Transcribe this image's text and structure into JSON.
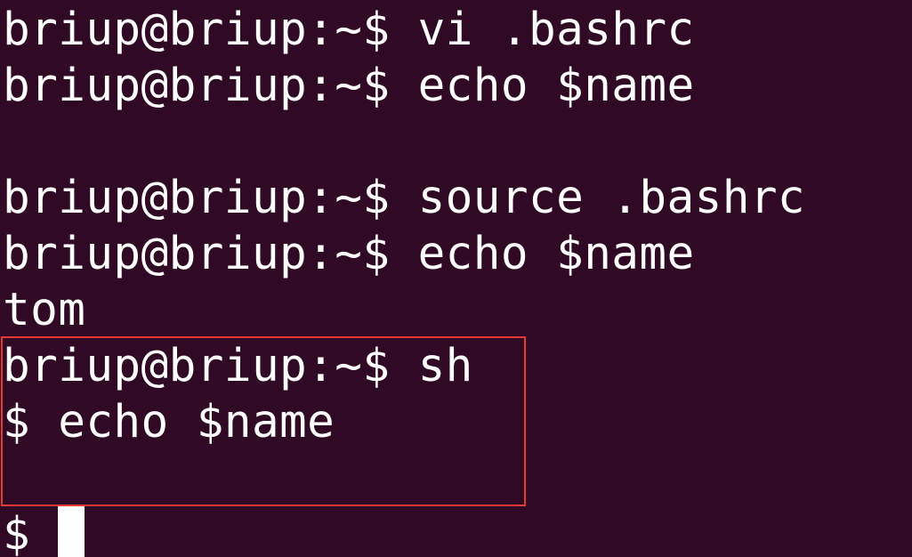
{
  "terminal": {
    "lines": [
      "briup@briup:~$ vi .bashrc",
      "briup@briup:~$ echo $name",
      "",
      "briup@briup:~$ source .bashrc",
      "briup@briup:~$ echo $name",
      "tom",
      "briup@briup:~$ sh",
      "$ echo $name",
      ""
    ],
    "current_prompt": "$ "
  },
  "colors": {
    "background": "#300a24",
    "text": "#ffffff",
    "highlight_border": "#e53935",
    "cursor": "#ffffff"
  }
}
